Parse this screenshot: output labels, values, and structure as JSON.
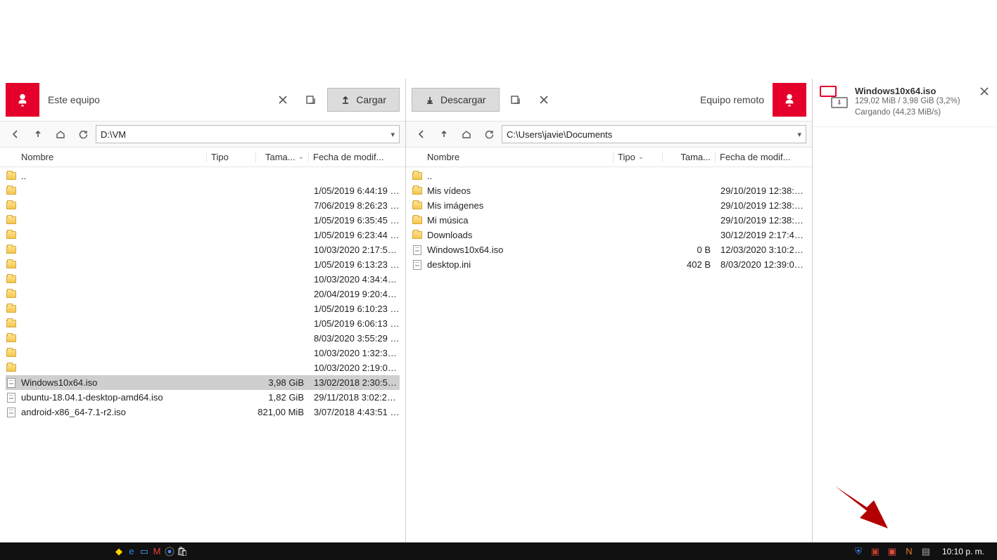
{
  "left": {
    "title": "Este equipo",
    "upload_label": "Cargar",
    "path": "D:\\VM",
    "columns": {
      "name": "Nombre",
      "type": "Tipo",
      "size": "Tama...",
      "date": "Fecha de modif..."
    },
    "items": [
      {
        "kind": "folder",
        "name": "..",
        "type": "",
        "size": "",
        "date": ""
      },
      {
        "kind": "folder",
        "name": "",
        "type": "",
        "size": "",
        "date": "1/05/2019 6:44:19 p..."
      },
      {
        "kind": "folder",
        "name": "",
        "type": "",
        "size": "",
        "date": "7/06/2019 8:26:23 p..."
      },
      {
        "kind": "folder",
        "name": "",
        "type": "",
        "size": "",
        "date": "1/05/2019 6:35:45 p..."
      },
      {
        "kind": "folder",
        "name": "",
        "type": "",
        "size": "",
        "date": "1/05/2019 6:23:44 p..."
      },
      {
        "kind": "folder",
        "name": "",
        "type": "",
        "size": "",
        "date": "10/03/2020 2:17:55 ..."
      },
      {
        "kind": "folder",
        "name": "",
        "type": "",
        "size": "",
        "date": "1/05/2019 6:13:23 p..."
      },
      {
        "kind": "folder",
        "name": "",
        "type": "",
        "size": "",
        "date": "10/03/2020 4:34:41 ..."
      },
      {
        "kind": "folder",
        "name": "",
        "type": "",
        "size": "",
        "date": "20/04/2019 9:20:46 ..."
      },
      {
        "kind": "folder",
        "name": "",
        "type": "",
        "size": "",
        "date": "1/05/2019 6:10:23 p..."
      },
      {
        "kind": "folder",
        "name": "",
        "type": "",
        "size": "",
        "date": "1/05/2019 6:06:13 p..."
      },
      {
        "kind": "folder",
        "name": "",
        "type": "",
        "size": "",
        "date": "8/03/2020 3:55:29 a..."
      },
      {
        "kind": "folder",
        "name": "",
        "type": "",
        "size": "",
        "date": "10/03/2020 1:32:35 ..."
      },
      {
        "kind": "folder",
        "name": "",
        "type": "",
        "size": "",
        "date": "10/03/2020 2:19:06 ..."
      },
      {
        "kind": "file",
        "name": "Windows10x64.iso",
        "type": "",
        "size": "3,98 GiB",
        "date": "13/02/2018 2:30:58 ...",
        "selected": true
      },
      {
        "kind": "file",
        "name": "ubuntu-18.04.1-desktop-amd64.iso",
        "type": "",
        "size": "1,82 GiB",
        "date": "29/11/2018 3:02:24 ..."
      },
      {
        "kind": "file",
        "name": "android-x86_64-7.1-r2.iso",
        "type": "",
        "size": "821,00 MiB",
        "date": "3/07/2018 4:43:51 p..."
      }
    ]
  },
  "right": {
    "title": "Equipo remoto",
    "download_label": "Descargar",
    "path": "C:\\Users\\javie\\Documents",
    "columns": {
      "name": "Nombre",
      "type": "Tipo",
      "size": "Tama...",
      "date": "Fecha de modif..."
    },
    "items": [
      {
        "kind": "folder",
        "name": "..",
        "type": "",
        "size": "",
        "date": ""
      },
      {
        "kind": "folder",
        "name": "Mis vídeos",
        "type": "",
        "size": "",
        "date": "29/10/2019 12:38:2..."
      },
      {
        "kind": "folder",
        "name": "Mis imágenes",
        "type": "",
        "size": "",
        "date": "29/10/2019 12:38:2..."
      },
      {
        "kind": "folder",
        "name": "Mi música",
        "type": "",
        "size": "",
        "date": "29/10/2019 12:38:2..."
      },
      {
        "kind": "folder",
        "name": "Downloads",
        "type": "",
        "size": "",
        "date": "30/12/2019 2:17:42 ..."
      },
      {
        "kind": "file",
        "name": "Windows10x64.iso",
        "type": "",
        "size": "0 B",
        "date": "12/03/2020 3:10:25 ..."
      },
      {
        "kind": "file",
        "name": "desktop.ini",
        "type": "",
        "size": "402 B",
        "date": "8/03/2020 12:39:09 ..."
      }
    ]
  },
  "transfer": {
    "name": "Windows10x64.iso",
    "progress": "129,02 MiB / 3,98 GiB (3,2%)",
    "status": "Cargando (44,23 MiB/s)"
  },
  "taskbar": {
    "clock": "10:10 p. m."
  }
}
